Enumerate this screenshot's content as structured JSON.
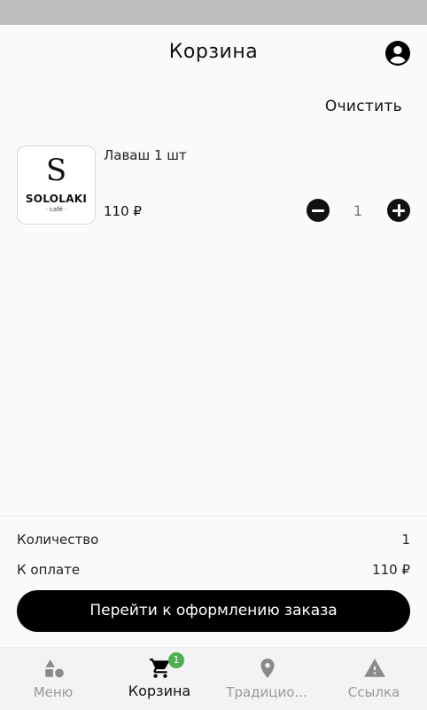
{
  "header": {
    "title": "Корзина"
  },
  "actions": {
    "clear_label": "Очистить"
  },
  "cart": {
    "items": [
      {
        "name": "Лаваш 1 шт",
        "price": "110 ₽",
        "quantity": "1",
        "logo": {
          "letter": "S",
          "word": "SOLOLAKI",
          "sub": "· café ·"
        }
      }
    ]
  },
  "summary": {
    "quantity_label": "Количество",
    "quantity_value": "1",
    "total_label": "К оплате",
    "total_value": "110 ₽",
    "checkout_label": "Перейти к оформлению заказа"
  },
  "nav": {
    "items": [
      {
        "label": "Меню",
        "icon": "shapes-icon"
      },
      {
        "label": "Корзина",
        "icon": "cart-icon",
        "badge": "1"
      },
      {
        "label": "Традицио...",
        "icon": "location-pin-icon"
      },
      {
        "label": "Ссылка",
        "icon": "warning-icon"
      }
    ]
  },
  "colors": {
    "accent": "#000000",
    "badge": "#4caf50",
    "inactive": "#9a9a9a"
  }
}
